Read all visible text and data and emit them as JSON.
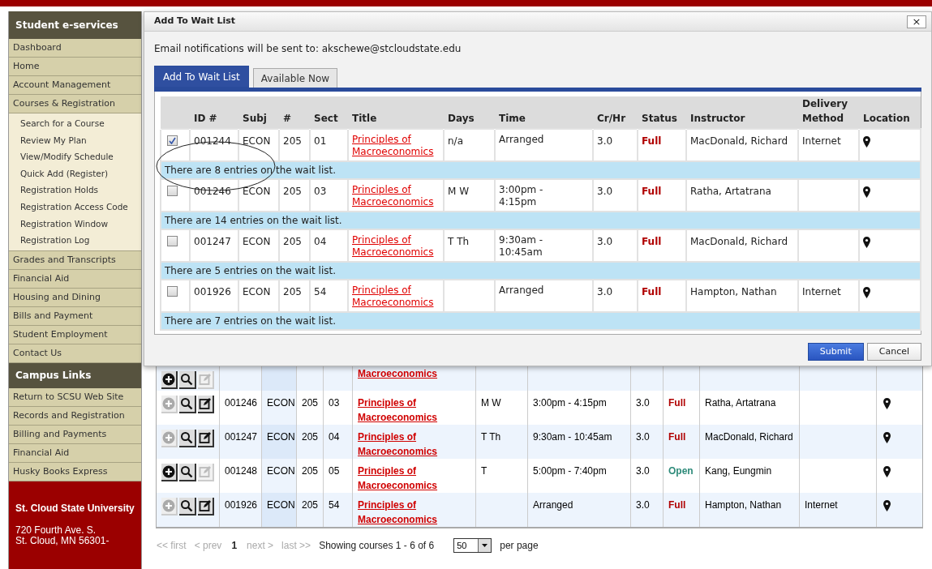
{
  "sidebar": {
    "sections": [
      {
        "title": "Student e-services",
        "items": [
          {
            "label": "Dashboard"
          },
          {
            "label": "Home"
          },
          {
            "label": "Account Management"
          },
          {
            "label": "Courses & Registration",
            "children": [
              {
                "label": "Search for a Course"
              },
              {
                "label": "Review My Plan"
              },
              {
                "label": "View/Modify Schedule"
              },
              {
                "label": "Quick Add (Register)"
              },
              {
                "label": "Registration Holds"
              },
              {
                "label": "Registration Access Code"
              },
              {
                "label": "Registration Window"
              },
              {
                "label": "Registration Log"
              }
            ]
          },
          {
            "label": "Grades and Transcripts"
          },
          {
            "label": "Financial Aid"
          },
          {
            "label": "Housing and Dining"
          },
          {
            "label": "Bills and Payment"
          },
          {
            "label": "Student Employment"
          },
          {
            "label": "Contact Us"
          }
        ]
      },
      {
        "title": "Campus Links",
        "items": [
          {
            "label": "Return to SCSU Web Site"
          },
          {
            "label": "Records and Registration"
          },
          {
            "label": "Billing and Payments"
          },
          {
            "label": "Financial Aid"
          },
          {
            "label": "Husky Books Express"
          }
        ]
      }
    ],
    "footer": {
      "name": "St. Cloud State University",
      "address_lines": [
        "720 Fourth Ave. S.",
        "St. Cloud, MN 56301-"
      ]
    }
  },
  "course_table": {
    "rows": [
      {
        "kind": "clipped",
        "add_enabled": true,
        "edit_enabled": false,
        "title": "Macroeconomics"
      },
      {
        "kind": "full",
        "add_enabled": false,
        "edit_enabled": true,
        "id": "001246",
        "subj": "ECON",
        "num": "205",
        "sect": "03",
        "title": "Principles of Macroeconomics",
        "days": "M W",
        "time": "3:00pm - 4:15pm",
        "credits": "3.0",
        "status": {
          "text": "Full",
          "kind": "full"
        },
        "instructor": "Ratha, Artatrana"
      },
      {
        "kind": "full",
        "add_enabled": false,
        "edit_enabled": true,
        "id": "001247",
        "subj": "ECON",
        "num": "205",
        "sect": "04",
        "title": "Principles of Macroeconomics",
        "days": "T Th",
        "time": "9:30am - 10:45am",
        "credits": "3.0",
        "status": {
          "text": "Full",
          "kind": "full"
        },
        "instructor": "MacDonald, Richard"
      },
      {
        "kind": "full",
        "add_enabled": true,
        "edit_enabled": false,
        "id": "001248",
        "subj": "ECON",
        "num": "205",
        "sect": "05",
        "title": "Principles of Macroeconomics",
        "days": "T",
        "time": "5:00pm - 7:40pm",
        "credits": "3.0",
        "status": {
          "text": "Open",
          "kind": "open"
        },
        "instructor": "Kang, Eungmin"
      },
      {
        "kind": "full",
        "add_enabled": false,
        "edit_enabled": true,
        "id": "001926",
        "subj": "ECON",
        "num": "205",
        "sect": "54",
        "title": "Principles of Macroeconomics",
        "time": "Arranged",
        "credits": "3.0",
        "status": {
          "text": "Full",
          "kind": "full"
        },
        "instructor": "Hampton, Nathan",
        "delivery": "Internet"
      }
    ]
  },
  "pagination": {
    "first": "<< first",
    "prev": "< prev",
    "current": "1",
    "next": "next >",
    "last": "last >>",
    "summary": "Showing courses 1 - 6 of 6",
    "per_page_value": "50",
    "per_page_label": "per page"
  },
  "dialog": {
    "title": "Add To Wait List",
    "close": "×",
    "email_note": "Email notifications will be sent to: akschewe@stcloudstate.edu",
    "tabs": [
      {
        "label": "Add To Wait List",
        "selected": true
      },
      {
        "label": "Available Now",
        "selected": false
      }
    ],
    "columns": [
      "ID #",
      "Subj",
      "#",
      "Sect",
      "Title",
      "Days",
      "Time",
      "Cr/Hr",
      "Status",
      "Instructor",
      "Delivery Method",
      "Location"
    ],
    "rows": [
      {
        "checked": true,
        "id": "001244",
        "subj": "ECON",
        "num": "205",
        "sect": "01",
        "title": "Principles of Macroeconomics",
        "days": "n/a",
        "time": "Arranged",
        "credits": "3.0",
        "status": {
          "text": "Full",
          "kind": "full"
        },
        "instructor": "MacDonald, Richard",
        "delivery": "Internet",
        "waitlist": "There are 8 entries on the wait list."
      },
      {
        "checked": false,
        "id": "001246",
        "subj": "ECON",
        "num": "205",
        "sect": "03",
        "title": "Principles of Macroeconomics",
        "days": "M W",
        "time": "3:00pm - 4:15pm",
        "credits": "3.0",
        "status": {
          "text": "Full",
          "kind": "full"
        },
        "instructor": "Ratha, Artatrana",
        "waitlist": "There are 14 entries on the wait list."
      },
      {
        "checked": false,
        "id": "001247",
        "subj": "ECON",
        "num": "205",
        "sect": "04",
        "title": "Principles of Macroeconomics",
        "days": "T Th",
        "time": "9:30am - 10:45am",
        "credits": "3.0",
        "status": {
          "text": "Full",
          "kind": "full"
        },
        "instructor": "MacDonald, Richard",
        "waitlist": "There are 5 entries on the wait list."
      },
      {
        "checked": false,
        "id": "001926",
        "subj": "ECON",
        "num": "205",
        "sect": "54",
        "title": "Principles of Macroeconomics",
        "time": "Arranged",
        "credits": "3.0",
        "status": {
          "text": "Full",
          "kind": "full"
        },
        "instructor": "Hampton, Nathan",
        "delivery": "Internet",
        "waitlist": "There are 7 entries on the wait list."
      }
    ],
    "buttons": [
      {
        "label": "Submit",
        "kind": "primary"
      },
      {
        "label": "Cancel",
        "kind": "secondary"
      }
    ]
  }
}
